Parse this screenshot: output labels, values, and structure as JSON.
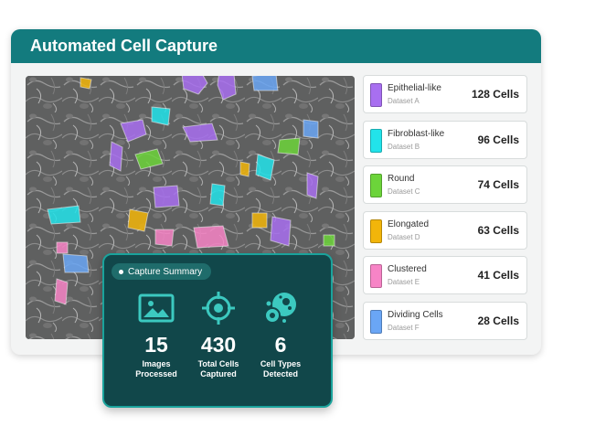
{
  "header": {
    "title": "Automated Cell Capture"
  },
  "cell_types": [
    {
      "name": "Epithelial-like",
      "dataset": "Dataset A",
      "count": "128 Cells",
      "color": "#a86ff0"
    },
    {
      "name": "Fibroblast-like",
      "dataset": "Dataset B",
      "count": "96 Cells",
      "color": "#22e3ea"
    },
    {
      "name": "Round",
      "dataset": "Dataset C",
      "count": "74 Cells",
      "color": "#6cd43a"
    },
    {
      "name": "Elongated",
      "dataset": "Dataset D",
      "count": "63 Cells",
      "color": "#f2b50a"
    },
    {
      "name": "Clustered",
      "dataset": "Dataset E",
      "count": "41 Cells",
      "color": "#f784c6"
    },
    {
      "name": "Dividing Cells",
      "dataset": "Dataset F",
      "count": "28 Cells",
      "color": "#6aa6f5"
    }
  ],
  "summary": {
    "badge": "Capture Summary",
    "stats": [
      {
        "value": "15",
        "label_line1": "Images",
        "label_line2": "Processed",
        "icon": "image-icon"
      },
      {
        "value": "430",
        "label_line1": "Total Cells",
        "label_line2": "Captured",
        "icon": "target-icon"
      },
      {
        "value": "6",
        "label_line1": "Cell Types",
        "label_line2": "Detected",
        "icon": "cells-icon"
      }
    ]
  },
  "colors": {
    "accent": "#137b7e",
    "summary_bg": "#11474a",
    "icon_teal": "#3cc9c0"
  }
}
